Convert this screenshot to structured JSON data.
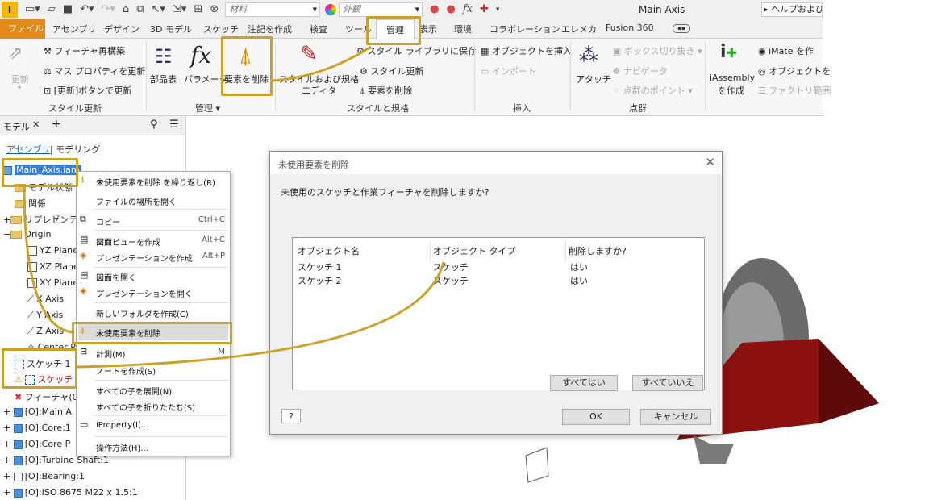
{
  "qat": {
    "logo": "I",
    "material": "材料",
    "appearance": "外観",
    "fx": "fx",
    "title": "Main Axis",
    "help": "ヘルプおよび"
  },
  "tabs": [
    "ファイル",
    "アセンブリ",
    "デザイン",
    "3D モデル",
    "スケッチ",
    "注記を作成",
    "検査",
    "ツール",
    "管理",
    "表示",
    "環境",
    "コラボレーション",
    "エレメカ",
    "Fusion 360"
  ],
  "ribbon": {
    "update": "更新",
    "rebuild": "フィーチャ再構築",
    "mass": "マス プロパティを更新",
    "update_btn": "[更新]ボタンで更新",
    "g_style_update": "スタイル更新",
    "bom": "部品表",
    "param": "パラメータ",
    "purge": "要素を削除",
    "g_manage": "管理",
    "style_editor_1": "スタイルおよび規格",
    "style_editor_2": "エディタ",
    "save_lib": "スタイル ライブラリに保存",
    "style_upd": "スタイル更新",
    "purge2": "要素を削除",
    "g_styles": "スタイルと規格",
    "insert_obj": "オブジェクトを挿入",
    "import": "インポート",
    "g_insert": "挿入",
    "attach": "アタッチ",
    "box": "ボックス切り抜き",
    "navigator": "ナビゲータ",
    "point_cloud": "点群のポイント",
    "g_point": "点群",
    "iassembly_1": "iAssembly",
    "iassembly_2": "を作成",
    "imate": "iMate を作",
    "obj": "オブジェクトを",
    "factory": "ファクトリ範囲"
  },
  "browser": {
    "title": "モデル",
    "tab_asm": "アセンブリ",
    "tab_model": "モデリング",
    "nodes": [
      "Main_Axis.iam",
      "モデル状態",
      "関係",
      "リプレゼンテ",
      "Origin",
      "YZ Plane",
      "XZ Plane",
      "XY Plane",
      "X Axis",
      "Y Axis",
      "Z Axis",
      "Center P",
      "スケッチ 1",
      "スケッチ",
      "フィーチャ(0)",
      "[O]:Main A",
      "[O]:Core:1",
      "[O]:Core P",
      "[O]:Turbine Shaft:1",
      "[O]:Bearing:1",
      "[O]:ISO 8675 M22 x 1.5:1"
    ]
  },
  "context_menu": [
    {
      "label": "未使用要素を削除 を繰り返し(R)",
      "shortcut": ""
    },
    {
      "label": "ファイルの場所を開く",
      "shortcut": ""
    },
    {
      "label": "コピー",
      "shortcut": "Ctrl+C"
    },
    {
      "label": "図面ビューを作成",
      "shortcut": "Alt+C"
    },
    {
      "label": "プレゼンテーションを作成",
      "shortcut": "Alt+P"
    },
    {
      "label": "図面を開く",
      "shortcut": ""
    },
    {
      "label": "プレゼンテーションを開く",
      "shortcut": ""
    },
    {
      "label": "新しいフォルダを作成(C)",
      "shortcut": ""
    },
    {
      "label": "未使用要素を削除",
      "shortcut": ""
    },
    {
      "label": "計測(M)",
      "shortcut": "M"
    },
    {
      "label": "ノートを作成(S)",
      "shortcut": ""
    },
    {
      "label": "すべての子を展開(N)",
      "shortcut": ""
    },
    {
      "label": "すべての子を折りたたむ(S)",
      "shortcut": ""
    },
    {
      "label": "iProperty(I)...",
      "shortcut": ""
    },
    {
      "label": "操作方法(H)...",
      "shortcut": ""
    }
  ],
  "dialog": {
    "title": "未使用要素を削除",
    "question": "未使用のスケッチと作業フィーチャを削除しますか?",
    "columns": [
      "オブジェクト名",
      "オブジェクト タイプ",
      "削除しますか?"
    ],
    "rows": [
      [
        "スケッチ 1",
        "スケッチ",
        "はい"
      ],
      [
        "スケッチ 2",
        "スケッチ",
        "はい"
      ]
    ],
    "all_yes": "すべてはい",
    "all_no": "すべていいえ",
    "ok": "OK",
    "cancel": "キャンセル",
    "help": "?"
  },
  "colors": {
    "accent": "#c9a227",
    "file_tab": "#e48a1a",
    "model_red": "#8b1010"
  }
}
